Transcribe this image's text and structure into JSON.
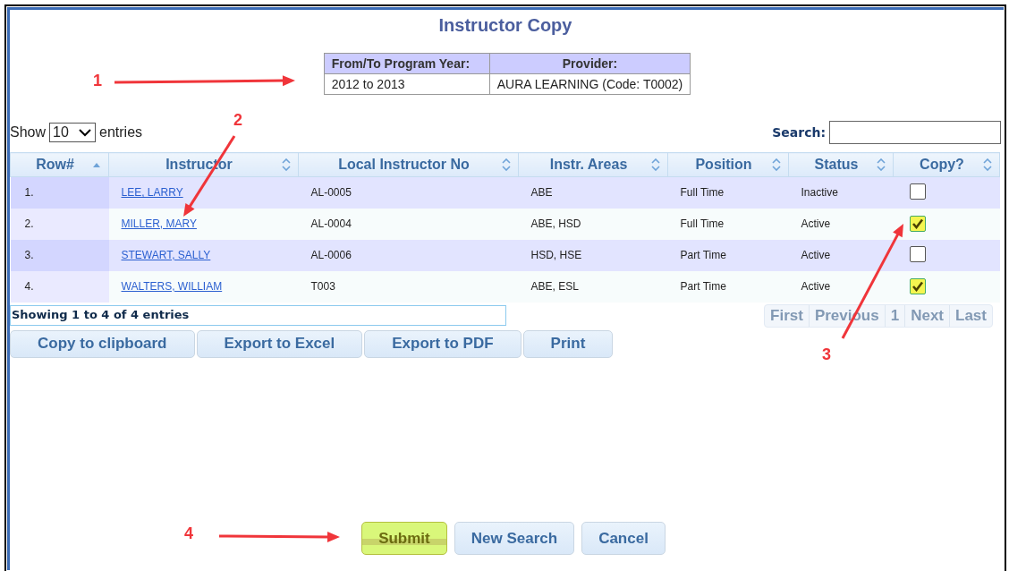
{
  "title": "Instructor Copy",
  "program_info": {
    "columns": [
      "From/To Program Year:",
      "Provider:"
    ],
    "values": [
      "2012 to 2013",
      "AURA LEARNING (Code: T0002)"
    ]
  },
  "length_menu": {
    "before": "Show",
    "value": "10",
    "after": "entries"
  },
  "search": {
    "label": "Search:"
  },
  "table": {
    "columns": [
      {
        "label": "Row#",
        "sorted": true
      },
      {
        "label": "Instructor",
        "sorted": false
      },
      {
        "label": "Local Instructor No",
        "sorted": false
      },
      {
        "label": "Instr. Areas",
        "sorted": false
      },
      {
        "label": "Position",
        "sorted": false
      },
      {
        "label": "Status",
        "sorted": false
      },
      {
        "label": "Copy?",
        "sorted": false
      }
    ],
    "rows": [
      {
        "row": "1.",
        "instructor": "LEE, LARRY",
        "local_no": "AL-0005",
        "areas": "ABE",
        "position": "Full Time",
        "status": "Inactive",
        "copy": false
      },
      {
        "row": "2.",
        "instructor": "MILLER, MARY",
        "local_no": "AL-0004",
        "areas": "ABE, HSD",
        "position": "Full Time",
        "status": "Active",
        "copy": true
      },
      {
        "row": "3.",
        "instructor": "STEWART, SALLY",
        "local_no": "AL-0006",
        "areas": "HSD, HSE",
        "position": "Part Time",
        "status": "Active",
        "copy": false
      },
      {
        "row": "4.",
        "instructor": "WALTERS, WILLIAM",
        "local_no": "T003",
        "areas": "ABE, ESL",
        "position": "Part Time",
        "status": "Active",
        "copy": true
      }
    ]
  },
  "info": "Showing 1 to 4 of 4 entries",
  "pagination": [
    {
      "label": "First",
      "disabled": true
    },
    {
      "label": "Previous",
      "disabled": true
    },
    {
      "label": "1",
      "disabled": true
    },
    {
      "label": "Next",
      "disabled": true
    },
    {
      "label": "Last",
      "disabled": true
    }
  ],
  "export_buttons": [
    "Copy to clipboard",
    "Export to Excel",
    "Export to PDF",
    "Print"
  ],
  "actions": [
    {
      "label": "Submit",
      "highlighted": true
    },
    {
      "label": "New Search",
      "highlighted": false
    },
    {
      "label": "Cancel",
      "highlighted": false
    }
  ],
  "annotations": [
    "1",
    "2",
    "3",
    "4"
  ]
}
